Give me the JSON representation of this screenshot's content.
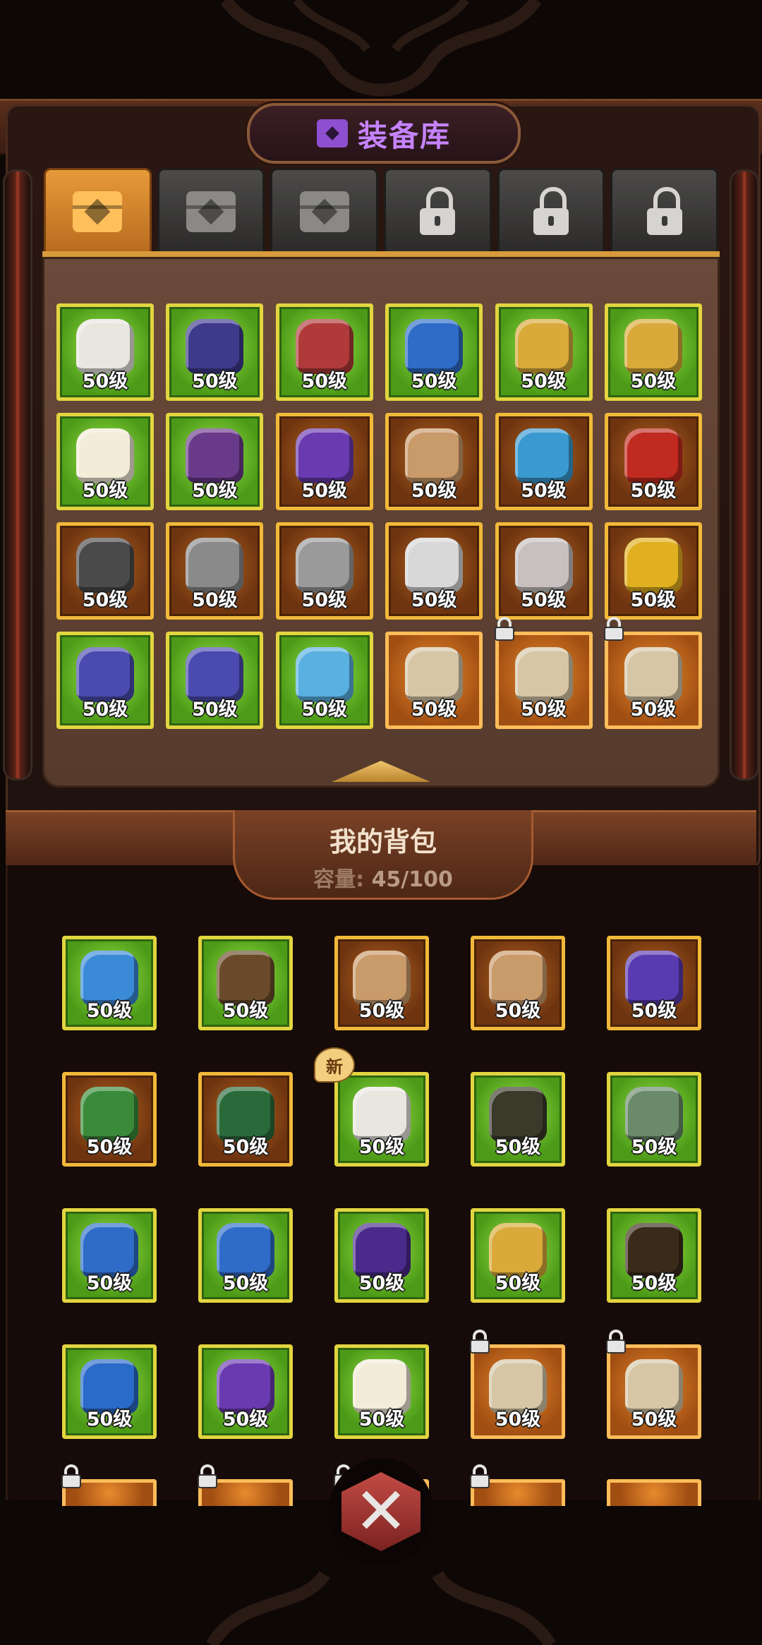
{
  "header": {
    "title": "装备库",
    "title_icon": "chest-icon",
    "accent": "#c583ff"
  },
  "tabs": [
    {
      "type": "chest",
      "state": "active"
    },
    {
      "type": "chest",
      "state": "inactive"
    },
    {
      "type": "chest",
      "state": "inactive"
    },
    {
      "type": "lock",
      "state": "locked"
    },
    {
      "type": "lock",
      "state": "locked"
    },
    {
      "type": "lock",
      "state": "locked"
    }
  ],
  "storage": {
    "items": [
      {
        "level": "50级",
        "rarity": "green",
        "icon": "white-chest-armor-icon",
        "color": "#e9e6e0"
      },
      {
        "level": "50级",
        "rarity": "green",
        "icon": "dark-dragon-helmet-icon",
        "color": "#3d3a8c"
      },
      {
        "level": "50级",
        "rarity": "green",
        "icon": "plumed-helmet-icon",
        "color": "#b03a3a"
      },
      {
        "level": "50级",
        "rarity": "green",
        "icon": "blue-pants-icon",
        "color": "#2f6cc8"
      },
      {
        "level": "50级",
        "rarity": "green",
        "icon": "gold-skirt-armor-icon",
        "color": "#d9a93a"
      },
      {
        "level": "50级",
        "rarity": "green",
        "icon": "gold-skirt-armor-icon",
        "color": "#d9a93a"
      },
      {
        "level": "50级",
        "rarity": "green",
        "icon": "white-boots-icon",
        "color": "#f2ecd8"
      },
      {
        "level": "50级",
        "rarity": "green",
        "icon": "purple-shield-icon",
        "color": "#6a3a8a"
      },
      {
        "level": "50级",
        "rarity": "orange",
        "icon": "purple-mace-icon",
        "color": "#6a3ab0"
      },
      {
        "level": "50级",
        "rarity": "orange",
        "icon": "horn-icon",
        "color": "#c99a6a"
      },
      {
        "level": "50级",
        "rarity": "orange",
        "icon": "blue-horn-icon",
        "color": "#3a9ad0"
      },
      {
        "level": "50级",
        "rarity": "orange",
        "icon": "red-plumed-helmet-icon",
        "color": "#c02a20"
      },
      {
        "level": "50级",
        "rarity": "orange",
        "icon": "spiked-helmet-icon",
        "color": "#4a4a4a"
      },
      {
        "level": "50级",
        "rarity": "orange",
        "icon": "fur-gauntlet-icon",
        "color": "#8a8a8a"
      },
      {
        "level": "50级",
        "rarity": "orange",
        "icon": "silver-greaves-icon",
        "color": "#9a9a9a"
      },
      {
        "level": "50级",
        "rarity": "orange",
        "icon": "silver-boots-icon",
        "color": "#d8d8d8"
      },
      {
        "level": "50级",
        "rarity": "orange",
        "icon": "round-helmet-icon",
        "color": "#c8c0c0"
      },
      {
        "level": "50级",
        "rarity": "orange",
        "icon": "gold-helmet-icon",
        "color": "#e0b020"
      },
      {
        "level": "50级",
        "rarity": "green",
        "icon": "purple-chest-armor-icon",
        "color": "#4a4ab0"
      },
      {
        "level": "50级",
        "rarity": "green",
        "icon": "purple-chest-armor-icon",
        "color": "#4a4ab0"
      },
      {
        "level": "50级",
        "rarity": "green",
        "icon": "blue-crystal-armor-icon",
        "color": "#5ab0e0"
      },
      {
        "level": "50级",
        "rarity": "bright",
        "icon": "sword-icon",
        "color": "#d6c6a6"
      },
      {
        "level": "50级",
        "rarity": "bright",
        "icon": "sword-icon",
        "color": "#d6c6a6",
        "locked": true
      },
      {
        "level": "50级",
        "rarity": "bright",
        "icon": "sword-icon",
        "color": "#d6c6a6",
        "locked": true
      }
    ]
  },
  "backpack": {
    "title": "我的背包",
    "capacity_label": "容量:",
    "capacity_value": "45/100",
    "items": [
      {
        "level": "50级",
        "rarity": "green",
        "icon": "blue-fur-armor-icon",
        "color": "#3a8ad8"
      },
      {
        "level": "50级",
        "rarity": "green",
        "icon": "antler-helmet-icon",
        "color": "#6a4a2a"
      },
      {
        "level": "50级",
        "rarity": "orange",
        "icon": "horn-icon",
        "color": "#c99a6a"
      },
      {
        "level": "50级",
        "rarity": "orange",
        "icon": "horn-icon",
        "color": "#c99a6a"
      },
      {
        "level": "50级",
        "rarity": "orange",
        "icon": "purple-horn-icon",
        "color": "#5a3ab0"
      },
      {
        "level": "50级",
        "rarity": "orange",
        "icon": "green-horn-icon",
        "color": "#3a8a3a"
      },
      {
        "level": "50级",
        "rarity": "orange",
        "icon": "green-chest-armor-icon",
        "color": "#2a6a3a"
      },
      {
        "level": "50级",
        "rarity": "green",
        "icon": "white-chest-armor-icon",
        "color": "#e9e6e0",
        "badge": "新"
      },
      {
        "level": "50级",
        "rarity": "green",
        "icon": "dark-skirt-armor-icon",
        "color": "#3a3a2a"
      },
      {
        "level": "50级",
        "rarity": "green",
        "icon": "green-pants-icon",
        "color": "#6a8a6a"
      },
      {
        "level": "50级",
        "rarity": "green",
        "icon": "blue-pants-icon",
        "color": "#2f6cc8"
      },
      {
        "level": "50级",
        "rarity": "green",
        "icon": "blue-pants-icon",
        "color": "#2f6cc8"
      },
      {
        "level": "50级",
        "rarity": "green",
        "icon": "purple-pants-icon",
        "color": "#4a2a8a"
      },
      {
        "level": "50级",
        "rarity": "green",
        "icon": "gold-skirt-armor-icon",
        "color": "#d9a93a"
      },
      {
        "level": "50级",
        "rarity": "green",
        "icon": "dark-boots-icon",
        "color": "#3a2a1a"
      },
      {
        "level": "50级",
        "rarity": "green",
        "icon": "fur-gloves-icon",
        "color": "#2a6ac8"
      },
      {
        "level": "50级",
        "rarity": "green",
        "icon": "purple-boots-icon",
        "color": "#6a3ab0"
      },
      {
        "level": "50级",
        "rarity": "green",
        "icon": "white-boots-icon",
        "color": "#f2ecd8"
      },
      {
        "level": "50级",
        "rarity": "bright",
        "icon": "sword-icon",
        "color": "#d6c6a6",
        "locked": true
      },
      {
        "level": "50级",
        "rarity": "bright",
        "icon": "sword-icon",
        "color": "#d6c6a6",
        "locked": true
      }
    ],
    "partial_row": [
      {
        "rarity": "bright",
        "locked": true
      },
      {
        "rarity": "bright",
        "locked": true
      },
      {
        "rarity": "bright",
        "locked": true
      },
      {
        "rarity": "bright",
        "locked": true
      },
      {
        "rarity": "bright",
        "locked": false
      }
    ]
  },
  "close_button": {
    "icon": "crossed-swords-close-icon",
    "glyph": "✕"
  }
}
